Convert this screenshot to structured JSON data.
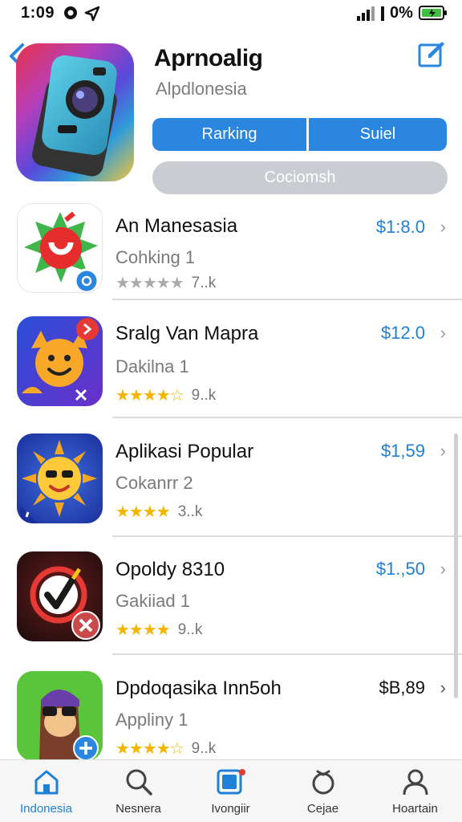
{
  "status_bar": {
    "time": "1:09",
    "battery_pct": "0%"
  },
  "header": {
    "title": "Aprnoalig",
    "subtitle": "Alpdlonesia",
    "segments": [
      "Rarking",
      "Suiel"
    ],
    "pill_label": "Cociomsh"
  },
  "apps": [
    {
      "name": "An Manesasia",
      "category": "Cohking 1",
      "stars": "★★★★★",
      "reviews": "7..k",
      "price": "$1:8.0",
      "stars_color": "#aaaaaa"
    },
    {
      "name": "Sralg Van Mapra",
      "category": "Dakilna 1",
      "stars": "★★★★☆",
      "reviews": "9..k",
      "price": "$12.0",
      "stars_color": "#f4b400"
    },
    {
      "name": "Aplikasi Popular",
      "category": "Cokanrr 2",
      "stars": "★★★★",
      "reviews": "3..k",
      "price": "$1,59",
      "stars_color": "#f4b400"
    },
    {
      "name": "Opoldy 8310",
      "category": "Gakiiad 1",
      "stars": "★★★★",
      "reviews": "9..k",
      "price": "$1.,50",
      "stars_color": "#f4b400"
    },
    {
      "name": "Dpdoqasika Inn5oh",
      "category": "Appliny 1",
      "stars": "★★★★☆",
      "reviews": "9..k",
      "price": "$B,89",
      "stars_color": "#f4b400"
    }
  ],
  "tabs": [
    {
      "label": "Indonesia",
      "icon": "home-icon"
    },
    {
      "label": "Nesnera",
      "icon": "search-icon"
    },
    {
      "label": "Ivongiir",
      "icon": "apps-icon"
    },
    {
      "label": "Cejae",
      "icon": "refresh-icon"
    },
    {
      "label": "Hoartain",
      "icon": "person-icon"
    }
  ],
  "colors": {
    "accent": "#2a86de",
    "price": "#1f80d6",
    "star": "#f4b400"
  }
}
